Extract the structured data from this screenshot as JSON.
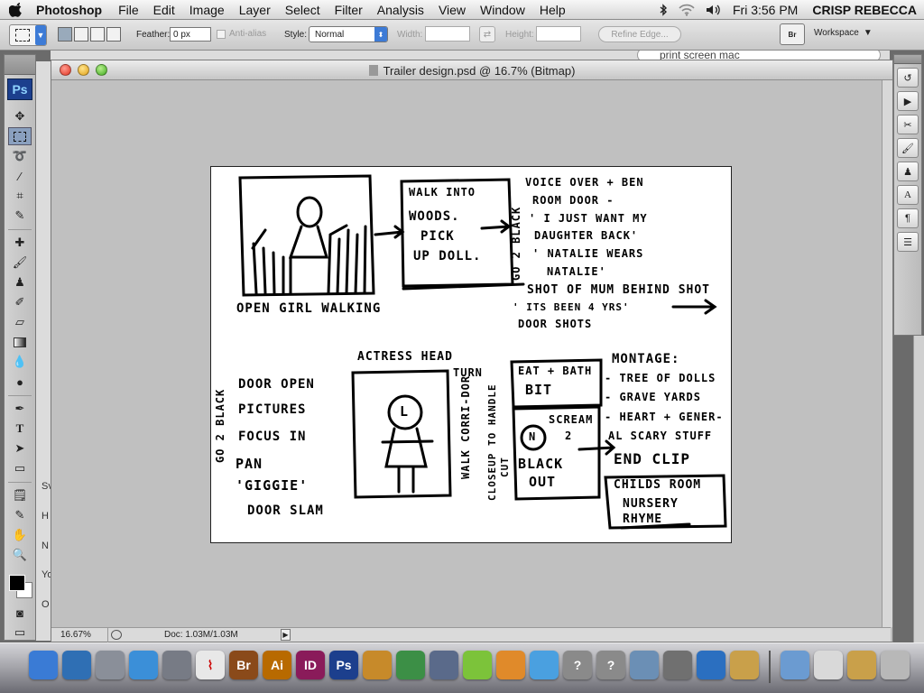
{
  "menubar": {
    "app_name": "Photoshop",
    "items": [
      "File",
      "Edit",
      "Image",
      "Layer",
      "Select",
      "Filter",
      "Analysis",
      "View",
      "Window",
      "Help"
    ],
    "clock": "Fri 3:56 PM",
    "user": "CRISP REBECCA",
    "status_icons": [
      "bluetooth-icon",
      "wifi-icon",
      "volume-icon"
    ]
  },
  "options": {
    "feather_label": "Feather:",
    "feather_value": "0 px",
    "antialias_label": "Anti-alias",
    "style_label": "Style:",
    "style_value": "Normal",
    "width_label": "Width:",
    "height_label": "Height:",
    "refine_label": "Refine Edge...",
    "bridge_label": "Br",
    "workspace_label": "Workspace"
  },
  "background_window": {
    "search_text": "print screen mac",
    "left_letters": [
      "Sv",
      "H",
      "N",
      "Yo",
      "O"
    ]
  },
  "tools": {
    "logo": "Ps",
    "items": [
      "move-tool",
      "marquee-tool",
      "lasso-tool",
      "magic-wand-tool",
      "crop-tool",
      "eyedropper-tool",
      "healing-brush-tool",
      "brush-tool",
      "clone-stamp-tool",
      "history-brush-tool",
      "eraser-tool",
      "gradient-tool",
      "blur-tool",
      "dodge-tool",
      "pen-tool",
      "type-tool",
      "path-selection-tool",
      "shape-tool",
      "notes-tool",
      "eyedropper-tool-2",
      "hand-tool",
      "zoom-tool"
    ],
    "selected": "marquee-tool",
    "foreground_color": "#000000",
    "background_color": "#ffffff"
  },
  "document": {
    "title": "Trailer design.psd @ 16.7% (Bitmap)",
    "zoom": "16.67%",
    "doc_size": "Doc: 1.03M/1.03M"
  },
  "storyboard": {
    "p1_caption": "OPEN GIRL WALKING",
    "p2_lines": [
      "WALK INTO",
      "WOODS.",
      "PICK",
      "UP DOLL."
    ],
    "go2black_1": "GO 2 BLACK",
    "vo_lines": [
      "VOICE OVER + BEN",
      "ROOM DOOR -",
      "' I JUST WANT MY",
      "DAUGHTER BACK'",
      "' NATALIE WEARS",
      "NATALIE'"
    ],
    "shot_lines": [
      "SHOT OF MUM BEHIND SHOT",
      "' ITS BEEN 4 YRS'",
      "DOOR SHOTS"
    ],
    "actress_head": "ACTRESS HEAD",
    "go2black_2": "GO 2 BLACK",
    "left_list": [
      "DOOR OPEN",
      "PICTURES",
      "FOCUS IN",
      "PAN",
      "'GIGGIE'",
      "DOOR SLAM"
    ],
    "actress_letter": "L",
    "turn": "TURN",
    "walk_corridor": "WALK CORRI-DOR",
    "closeup": "CLOSEUP TO HANDLE",
    "cut": "CUT",
    "eat_bath": [
      "EAT + BATH",
      "BIT"
    ],
    "n_letter": "N",
    "scream": [
      "SCREAM",
      "2"
    ],
    "black_out": [
      "BLACK",
      "OUT"
    ],
    "montage_title": "MONTAGE:",
    "montage_lines": [
      "- TREE OF DOLLS",
      "- GRAVE YARDS",
      "- HEART + GENER-",
      "AL SCARY STUFF"
    ],
    "end_clip": "END CLIP",
    "childs_room": [
      "CHILDS ROOM",
      "NURSERY",
      "RHYME"
    ]
  },
  "panels": {
    "right_strip": [
      "history-panel-icon",
      "actions-panel-icon",
      "tools-panel-icon",
      "brushes-panel-icon",
      "clone-source-icon",
      "character-panel-icon",
      "paragraph-panel-icon",
      "layers-panel-icon"
    ]
  },
  "dock": {
    "items": [
      {
        "name": "finder-icon",
        "label": "",
        "color": "#3a7bd5"
      },
      {
        "name": "dashboard-icon",
        "label": "",
        "color": "#2f6fb4"
      },
      {
        "name": "preview-icon",
        "label": "",
        "color": "#8a8f99"
      },
      {
        "name": "safari-icon",
        "label": "",
        "color": "#3b8fd8"
      },
      {
        "name": "system-preferences-icon",
        "label": "",
        "color": "#777b85"
      },
      {
        "name": "acrobat-icon",
        "label": "",
        "color": "#e8e8e8"
      },
      {
        "name": "bridge-icon",
        "label": "Br",
        "color": "#8a4a1a"
      },
      {
        "name": "illustrator-icon",
        "label": "Ai",
        "color": "#b86a00"
      },
      {
        "name": "indesign-icon",
        "label": "ID",
        "color": "#8a1b5a"
      },
      {
        "name": "photoshop-icon",
        "label": "Ps",
        "color": "#1c3f8d"
      },
      {
        "name": "keynote-icon",
        "label": "",
        "color": "#c78a2a"
      },
      {
        "name": "numbers-icon",
        "label": "",
        "color": "#3c8f46"
      },
      {
        "name": "utilities-icon",
        "label": "",
        "color": "#5a6a8a"
      },
      {
        "name": "lime-app-icon",
        "label": "",
        "color": "#7cc33a"
      },
      {
        "name": "pages-icon",
        "label": "",
        "color": "#e08a2a"
      },
      {
        "name": "web-app-icon",
        "label": "",
        "color": "#4aa0e0"
      },
      {
        "name": "unknown-app-icon",
        "label": "?",
        "color": "#8a8a8a"
      },
      {
        "name": "unknown-app-icon-2",
        "label": "?",
        "color": "#8a8a8a"
      },
      {
        "name": "iphoto-icon",
        "label": "",
        "color": "#6b8fb5"
      },
      {
        "name": "image-capture-icon",
        "label": "",
        "color": "#707070"
      },
      {
        "name": "quicktime-icon",
        "label": "",
        "color": "#2b6fc0"
      },
      {
        "name": "user-folder-icon",
        "label": "",
        "color": "#c9a04a"
      }
    ],
    "right_items": [
      {
        "name": "applications-folder-icon",
        "color": "#6b9bd1"
      },
      {
        "name": "documents-stack-icon",
        "color": "#d9d9d9"
      },
      {
        "name": "downloads-stack-icon",
        "color": "#c9a04a"
      },
      {
        "name": "trash-icon",
        "color": "#b8b8b8"
      }
    ]
  }
}
